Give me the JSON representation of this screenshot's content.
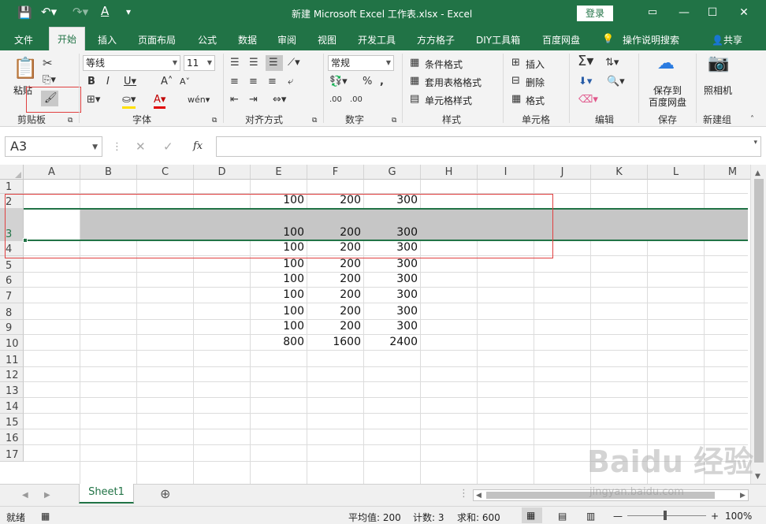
{
  "window": {
    "title": "新建 Microsoft Excel 工作表.xlsx  -  Excel",
    "login": "登录"
  },
  "tabs": [
    "文件",
    "开始",
    "插入",
    "页面布局",
    "公式",
    "数据",
    "审阅",
    "视图",
    "开发工具",
    "方方格子",
    "DIY工具箱",
    "百度网盘",
    "操作说明搜索",
    "共享"
  ],
  "active_tab": "开始",
  "ribbon": {
    "clipboard": {
      "paste": "粘贴",
      "group": "剪贴板"
    },
    "font": {
      "name": "等线",
      "size": "11",
      "group": "字体"
    },
    "align": {
      "group": "对齐方式"
    },
    "number": {
      "format": "常规",
      "group": "数字"
    },
    "styles": {
      "cond": "条件格式",
      "table": "套用表格格式",
      "cell": "单元格样式",
      "group": "样式"
    },
    "cells": {
      "insert": "插入",
      "delete": "删除",
      "format": "格式",
      "group": "单元格"
    },
    "editing": {
      "group": "编辑"
    },
    "save": {
      "label1": "保存到",
      "label2": "百度网盘",
      "group": "保存"
    },
    "camera": {
      "label": "照相机",
      "group": "新建组"
    }
  },
  "formula_bar": {
    "name_box": "A3",
    "fx": "fx",
    "value": ""
  },
  "columns": [
    "A",
    "B",
    "C",
    "D",
    "E",
    "F",
    "G",
    "H",
    "I",
    "J",
    "K",
    "L",
    "M"
  ],
  "rows": [
    {
      "num": "1",
      "E": "",
      "F": "",
      "G": ""
    },
    {
      "num": "2",
      "E": "100",
      "F": "200",
      "G": "300"
    },
    {
      "num": "3",
      "E": "100",
      "F": "200",
      "G": "300"
    },
    {
      "num": "4",
      "E": "100",
      "F": "200",
      "G": "300"
    },
    {
      "num": "5",
      "E": "100",
      "F": "200",
      "G": "300"
    },
    {
      "num": "6",
      "E": "100",
      "F": "200",
      "G": "300"
    },
    {
      "num": "7",
      "E": "100",
      "F": "200",
      "G": "300"
    },
    {
      "num": "8",
      "E": "100",
      "F": "200",
      "G": "300"
    },
    {
      "num": "9",
      "E": "100",
      "F": "200",
      "G": "300"
    },
    {
      "num": "10",
      "E": "800",
      "F": "1600",
      "G": "2400"
    },
    {
      "num": "11",
      "E": "",
      "F": "",
      "G": ""
    },
    {
      "num": "12",
      "E": "",
      "F": "",
      "G": ""
    },
    {
      "num": "13",
      "E": "",
      "F": "",
      "G": ""
    },
    {
      "num": "14",
      "E": "",
      "F": "",
      "G": ""
    },
    {
      "num": "15",
      "E": "",
      "F": "",
      "G": ""
    },
    {
      "num": "16",
      "E": "",
      "F": "",
      "G": ""
    },
    {
      "num": "17",
      "E": "",
      "F": "",
      "G": ""
    }
  ],
  "sheet": {
    "name": "Sheet1"
  },
  "status": {
    "mode": "就绪",
    "average": "平均值: 200",
    "count": "计数: 3",
    "sum": "求和: 600",
    "zoom": "100%"
  },
  "watermark": {
    "main": "Baidu 经验",
    "sub": "jingyan.baidu.com"
  }
}
